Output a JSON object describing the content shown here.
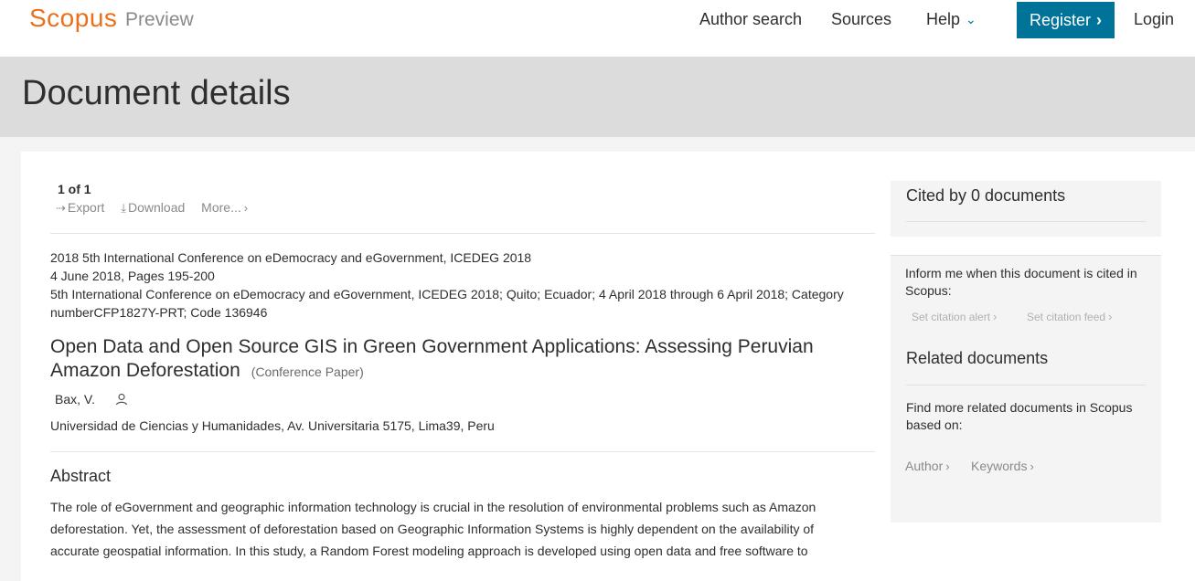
{
  "header": {
    "logo": "Scopus",
    "logo_sub": "Preview",
    "nav": {
      "author_search": "Author search",
      "sources": "Sources",
      "help": "Help",
      "register": "Register",
      "login": "Login"
    },
    "accent_color": "#007398",
    "brand_color": "#e9711c"
  },
  "page": {
    "title": "Document details"
  },
  "document": {
    "counter": "1 of 1",
    "actions": {
      "export": "Export",
      "download": "Download",
      "more": "More..."
    },
    "source_lines": [
      "2018 5th International Conference on eDemocracy and eGovernment, ICEDEG 2018",
      "4 June 2018, Pages 195-200",
      "5th International Conference on eDemocracy and eGovernment, ICEDEG 2018; Quito; Ecuador; 4 April 2018 through 6 April 2018; Category numberCFP1827Y-PRT; Code 136946"
    ],
    "title": "Open Data and Open Source GIS in Green Government Applications: Assessing Peruvian Amazon Deforestation",
    "type": "(Conference Paper)",
    "author": "Bax, V.",
    "affiliation": "Universidad de Ciencias y Humanidades, Av. Universitaria 5175, Lima39, Peru",
    "abstract_heading": "Abstract",
    "abstract_lines": [
      "The role of eGovernment and geographic information technology is crucial in the resolution of environmental problems such as Amazon",
      "deforestation. Yet, the assessment of deforestation based on Geographic Information Systems is highly dependent on the availability of",
      "accurate geospatial information. In this study, a Random Forest modeling approach is developed using open data and free software to"
    ]
  },
  "sidebar": {
    "cited_by": "Cited by 0 documents",
    "inform_text": "Inform me when this document is cited in Scopus:",
    "set_citation_alert": "Set citation alert",
    "set_citation_feed": "Set citation feed",
    "related_heading": "Related documents",
    "find_text": "Find more related documents in Scopus based on:",
    "author_link": "Author",
    "keywords_link": "Keywords"
  }
}
